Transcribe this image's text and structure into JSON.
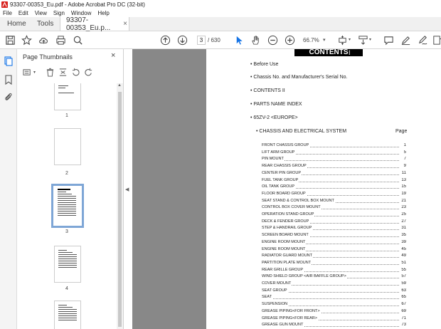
{
  "window": {
    "title": "93307-00353_Eu.pdf - Adobe Acrobat Pro DC (32-bit)"
  },
  "menu": [
    "File",
    "Edit",
    "View",
    "Sign",
    "Window",
    "Help"
  ],
  "tabs": {
    "home": "Home",
    "tools": "Tools",
    "doc": "93307-00353_Eu.p...",
    "close": "×"
  },
  "toolbar": {
    "page_current": "3",
    "page_total": "/ 630",
    "zoom": "66.7%"
  },
  "panel": {
    "title": "Page Thumbnails",
    "close": "×",
    "thumbnails": [
      {
        "label": "1"
      },
      {
        "label": "2"
      },
      {
        "label": "3",
        "selected": true
      },
      {
        "label": "4"
      }
    ]
  },
  "page": {
    "heading": "CONTENTS",
    "sections": [
      "• Before Use",
      "• Chassis No. and Manufacturer's Serial No.",
      "• CONTENTS II",
      "• PARTS NAME INDEX",
      "• 65ZV-2 <EUROPE>"
    ],
    "subsection": "• CHASSIS AND ELECTRICAL SYSTEM",
    "page_col": "Page",
    "toc": [
      {
        "t": "FRONT CHASSIS GROUP",
        "p": "1"
      },
      {
        "t": "LIFT ARM GROUP",
        "p": "5"
      },
      {
        "t": "PIN MOUNT",
        "p": "7"
      },
      {
        "t": "REAR CHASSIS GROUP",
        "p": "9"
      },
      {
        "t": "CENTER PIN GROUP",
        "p": "11"
      },
      {
        "t": "FUEL TANK GROUP",
        "p": "13"
      },
      {
        "t": "OIL TANK GROUP",
        "p": "15"
      },
      {
        "t": "FLOOR BOARD GROUP",
        "p": "19"
      },
      {
        "t": "SEAT STAND & CONTROL BOX MOUNT",
        "p": "21"
      },
      {
        "t": "CONTROL BOX COVER MOUNT",
        "p": "23"
      },
      {
        "t": "OPERATION STAND GROUP",
        "p": "25"
      },
      {
        "t": "DECK & FENDER GROUP",
        "p": "27"
      },
      {
        "t": "STEP & HANDRAIL GROUP",
        "p": "31"
      },
      {
        "t": "SCREEN BOARD MOUNT",
        "p": "35"
      },
      {
        "t": "ENGINE ROOM MOUNT",
        "p": "39"
      },
      {
        "t": "ENGINE ROOM MOUNT",
        "p": "45"
      },
      {
        "t": "RADIATOR GUARD MOUNT",
        "p": "49"
      },
      {
        "t": "PARTITION PLATE MOUNT",
        "p": "51"
      },
      {
        "t": "REAR GRILLE GROUP",
        "p": "55"
      },
      {
        "t": "WIND SHIELD GROUP <AIR BAFFLE GROUP>",
        "p": "57"
      },
      {
        "t": "COVER MOUNT",
        "p": "59"
      },
      {
        "t": "SEAT GROUP",
        "p": "63"
      },
      {
        "t": "SEAT",
        "p": "65"
      },
      {
        "t": "SUSPENSION",
        "p": "67"
      },
      {
        "t": "GREASE PIPING<FOR FRONT>",
        "p": "69"
      },
      {
        "t": "GREASE PIPING<FOR REAR>",
        "p": "71"
      },
      {
        "t": "GREASE GUN MOUNT",
        "p": "73"
      }
    ]
  }
}
